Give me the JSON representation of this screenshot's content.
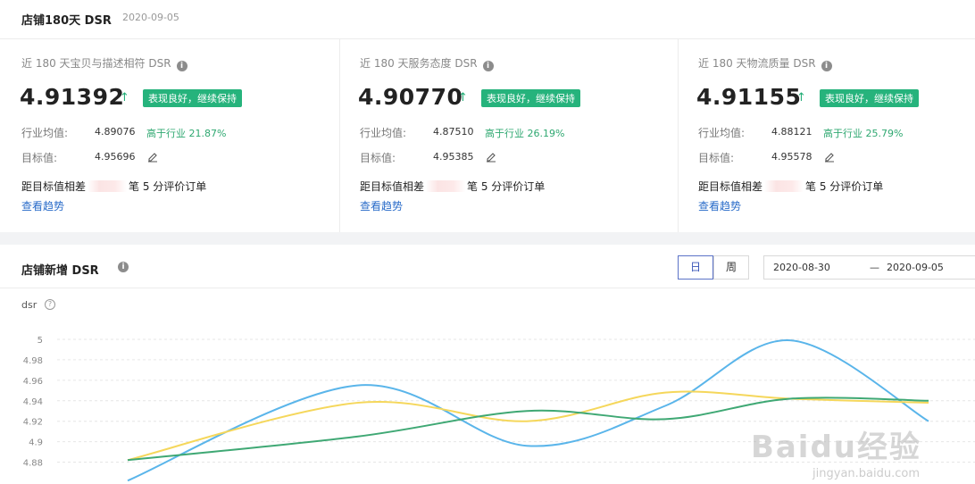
{
  "header": {
    "title": "店铺180天 DSR",
    "date": "2020-09-05"
  },
  "cards": [
    {
      "title": "近 180 天宝贝与描述相符 DSR",
      "value": "4.91392",
      "badge": "表现良好，继续保持",
      "industry_label": "行业均值:",
      "industry_value": "4.89076",
      "industry_compare": "高于行业 21.87%",
      "target_label": "目标值:",
      "target_value": "4.95696",
      "gap_prefix": "距目标值相差",
      "gap_suffix": "笔 5 分评价订单",
      "trend_link": "查看趋势"
    },
    {
      "title": "近 180 天服务态度 DSR",
      "value": "4.90770",
      "badge": "表现良好，继续保持",
      "industry_label": "行业均值:",
      "industry_value": "4.87510",
      "industry_compare": "高于行业 26.19%",
      "target_label": "目标值:",
      "target_value": "4.95385",
      "gap_prefix": "距目标值相差",
      "gap_suffix": "笔 5 分评价订单",
      "trend_link": "查看趋势"
    },
    {
      "title": "近 180 天物流质量 DSR",
      "value": "4.91155",
      "badge": "表现良好，继续保持",
      "industry_label": "行业均值:",
      "industry_value": "4.88121",
      "industry_compare": "高于行业 25.79%",
      "target_label": "目标值:",
      "target_value": "4.95578",
      "gap_prefix": "距目标值相差",
      "gap_suffix": "笔 5 分评价订单",
      "trend_link": "查看趋势"
    }
  ],
  "chart_section": {
    "title": "店铺新增 DSR",
    "toggle_day": "日",
    "toggle_week": "周",
    "date_start": "2020-08-30",
    "date_sep": "—",
    "date_end": "2020-09-05",
    "legend_label": "dsr"
  },
  "chart_data": {
    "type": "line",
    "ylim": [
      4.87,
      5.0
    ],
    "yticks": [
      "5",
      "4.98",
      "4.96",
      "4.94",
      "4.92",
      "4.9",
      "4.88"
    ],
    "series": [
      {
        "color": "#5ab5ea",
        "values": [
          4.862,
          4.955,
          4.896,
          4.935,
          4.999,
          4.92
        ]
      },
      {
        "color": "#f5d75b",
        "values": [
          4.882,
          4.938,
          4.92,
          4.948,
          4.942,
          4.938
        ]
      },
      {
        "color": "#3fa874",
        "values": [
          4.882,
          4.905,
          4.93,
          4.922,
          4.942,
          4.94
        ]
      }
    ]
  },
  "watermark": {
    "brand": "Baidu经验",
    "url": "jingyan.baidu.com"
  }
}
